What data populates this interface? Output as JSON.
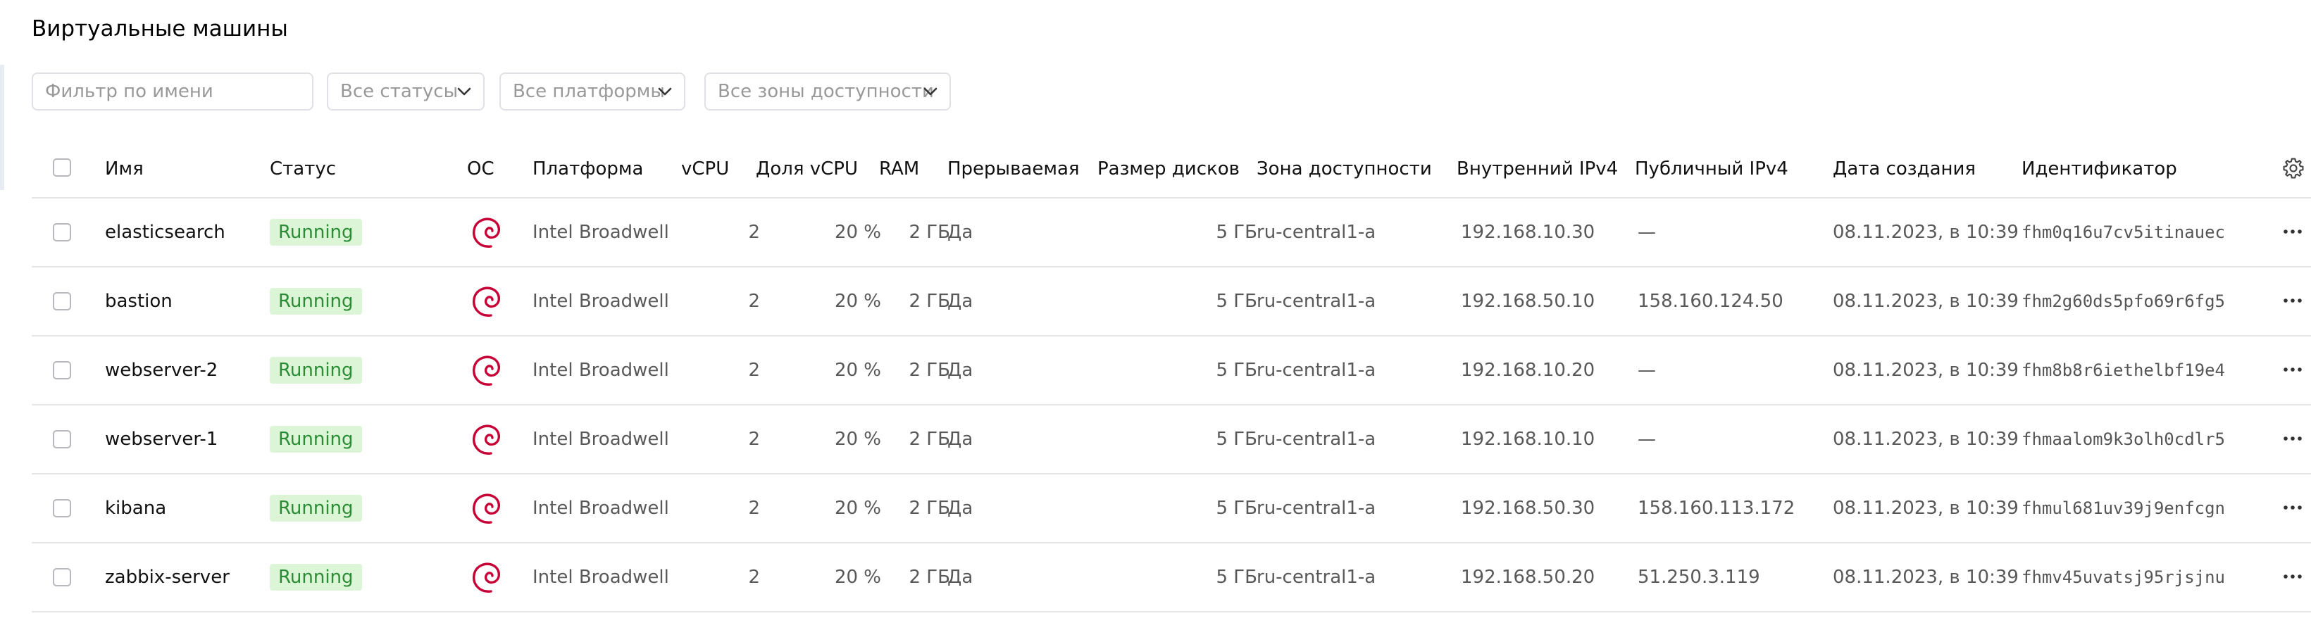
{
  "page": {
    "title": "Виртуальные машины"
  },
  "filters": {
    "name_placeholder": "Фильтр по имени",
    "status": "Все статусы",
    "platform": "Все платформы",
    "zone": "Все зоны доступности"
  },
  "table": {
    "columns": {
      "name": "Имя",
      "status": "Статус",
      "os": "ОС",
      "platform": "Платформа",
      "vcpu": "vCPU",
      "vcpu_share": "Доля vCPU",
      "ram": "RAM",
      "preemptible": "Прерываемая",
      "disk_size": "Размер дисков",
      "zone": "Зона доступности",
      "internal_ip": "Внутренний IPv4",
      "public_ip": "Публичный IPv4",
      "created": "Дата создания",
      "id": "Идентификатор"
    },
    "rows": [
      {
        "name": "elasticsearch",
        "status": "Running",
        "os_icon": "debian-icon",
        "platform": "Intel Broadwell",
        "vcpu": "2",
        "vcpu_share": "20 %",
        "ram": "2 ГБ",
        "preemptible": "Да",
        "disk_size": "5 ГБ",
        "zone": "ru-central1-a",
        "internal_ip": "192.168.10.30",
        "public_ip": "—",
        "created": "08.11.2023, в 10:39",
        "id": "fhm0q16u7cv5itinauec"
      },
      {
        "name": "bastion",
        "status": "Running",
        "os_icon": "debian-icon",
        "platform": "Intel Broadwell",
        "vcpu": "2",
        "vcpu_share": "20 %",
        "ram": "2 ГБ",
        "preemptible": "Да",
        "disk_size": "5 ГБ",
        "zone": "ru-central1-a",
        "internal_ip": "192.168.50.10",
        "public_ip": "158.160.124.50",
        "created": "08.11.2023, в 10:39",
        "id": "fhm2g60ds5pfo69r6fg5"
      },
      {
        "name": "webserver-2",
        "status": "Running",
        "os_icon": "debian-icon",
        "platform": "Intel Broadwell",
        "vcpu": "2",
        "vcpu_share": "20 %",
        "ram": "2 ГБ",
        "preemptible": "Да",
        "disk_size": "5 ГБ",
        "zone": "ru-central1-a",
        "internal_ip": "192.168.10.20",
        "public_ip": "—",
        "created": "08.11.2023, в 10:39",
        "id": "fhm8b8r6iethelbf19e4"
      },
      {
        "name": "webserver-1",
        "status": "Running",
        "os_icon": "debian-icon",
        "platform": "Intel Broadwell",
        "vcpu": "2",
        "vcpu_share": "20 %",
        "ram": "2 ГБ",
        "preemptible": "Да",
        "disk_size": "5 ГБ",
        "zone": "ru-central1-a",
        "internal_ip": "192.168.10.10",
        "public_ip": "—",
        "created": "08.11.2023, в 10:39",
        "id": "fhmaalom9k3olh0cdlr5"
      },
      {
        "name": "kibana",
        "status": "Running",
        "os_icon": "debian-icon",
        "platform": "Intel Broadwell",
        "vcpu": "2",
        "vcpu_share": "20 %",
        "ram": "2 ГБ",
        "preemptible": "Да",
        "disk_size": "5 ГБ",
        "zone": "ru-central1-a",
        "internal_ip": "192.168.50.30",
        "public_ip": "158.160.113.172",
        "created": "08.11.2023, в 10:39",
        "id": "fhmul681uv39j9enfcgn"
      },
      {
        "name": "zabbix-server",
        "status": "Running",
        "os_icon": "debian-icon",
        "platform": "Intel Broadwell",
        "vcpu": "2",
        "vcpu_share": "20 %",
        "ram": "2 ГБ",
        "preemptible": "Да",
        "disk_size": "5 ГБ",
        "zone": "ru-central1-a",
        "internal_ip": "192.168.50.20",
        "public_ip": "51.250.3.119",
        "created": "08.11.2023, в 10:39",
        "id": "fhmv45uvatsj95rjsjnu"
      }
    ]
  },
  "colors": {
    "running_badge_bg": "#dbf5d6",
    "running_badge_text": "#2b8c36",
    "debian_red": "#c70036"
  }
}
